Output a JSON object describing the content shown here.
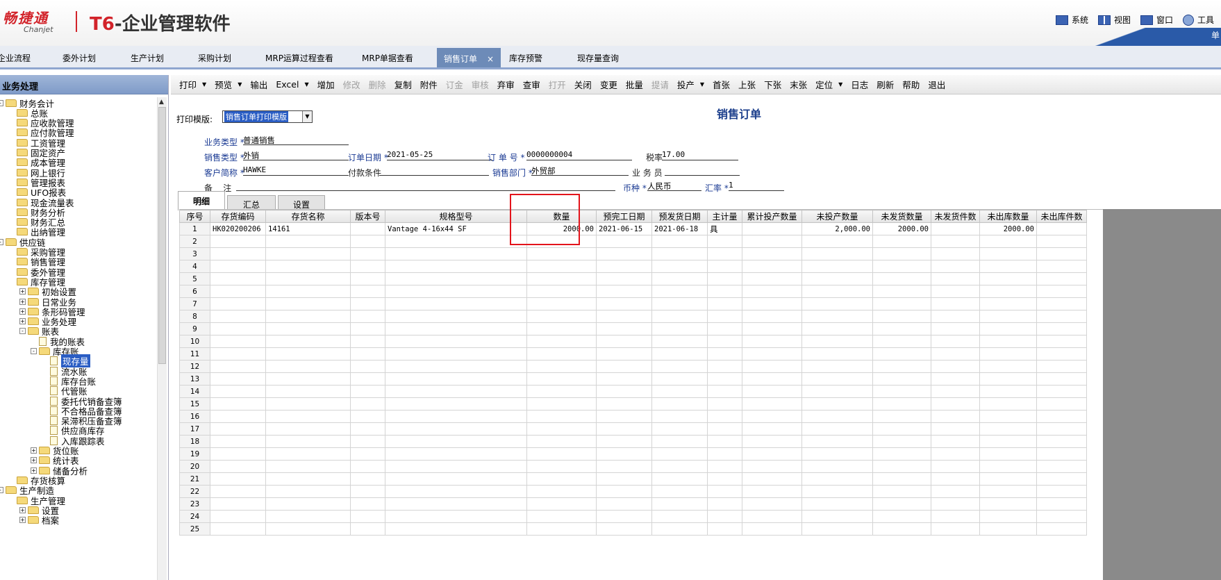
{
  "header": {
    "brand_cn": "畅捷通",
    "brand_en": "Chanjet",
    "product_title_prefix": "T6",
    "product_title": "-企业管理软件",
    "menu": [
      {
        "label": "系统",
        "icon": "monitor-icon"
      },
      {
        "label": "视图",
        "icon": "grid-icon"
      },
      {
        "label": "窗口",
        "icon": "window-icon"
      },
      {
        "label": "工具",
        "icon": "gear-icon"
      }
    ],
    "swoosh_text": "单"
  },
  "tabs": [
    {
      "label": "企业流程"
    },
    {
      "label": "委外计划"
    },
    {
      "label": "生产计划"
    },
    {
      "label": "采购计划"
    },
    {
      "label": "MRP运算过程查看"
    },
    {
      "label": "MRP单据查看"
    },
    {
      "label": "销售订单",
      "active": true,
      "close": "×"
    },
    {
      "label": "库存预警"
    },
    {
      "label": "现存量查询"
    }
  ],
  "left": {
    "title": "业务处理",
    "tree": [
      {
        "label": "财务会计",
        "level": 0,
        "exp": "-",
        "icon": "folder"
      },
      {
        "label": "总账",
        "level": 1,
        "icon": "folder"
      },
      {
        "label": "应收款管理",
        "level": 1,
        "icon": "folder"
      },
      {
        "label": "应付款管理",
        "level": 1,
        "icon": "folder"
      },
      {
        "label": "工资管理",
        "level": 1,
        "icon": "folder"
      },
      {
        "label": "固定资产",
        "level": 1,
        "icon": "folder"
      },
      {
        "label": "成本管理",
        "level": 1,
        "icon": "folder"
      },
      {
        "label": "网上银行",
        "level": 1,
        "icon": "folder"
      },
      {
        "label": "管理报表",
        "level": 1,
        "icon": "folder"
      },
      {
        "label": "UFO报表",
        "level": 1,
        "icon": "folder"
      },
      {
        "label": "现金流量表",
        "level": 1,
        "icon": "folder"
      },
      {
        "label": "财务分析",
        "level": 1,
        "icon": "folder"
      },
      {
        "label": "财务汇总",
        "level": 1,
        "icon": "folder"
      },
      {
        "label": "出纳管理",
        "level": 1,
        "icon": "folder"
      },
      {
        "label": "供应链",
        "level": 0,
        "exp": "-",
        "icon": "folder"
      },
      {
        "label": "采购管理",
        "level": 1,
        "icon": "folder"
      },
      {
        "label": "销售管理",
        "level": 1,
        "icon": "folder"
      },
      {
        "label": "委外管理",
        "level": 1,
        "icon": "folder"
      },
      {
        "label": "库存管理",
        "level": 1,
        "icon": "folder"
      },
      {
        "label": "初始设置",
        "level": 2,
        "exp": "+",
        "icon": "folder"
      },
      {
        "label": "日常业务",
        "level": 2,
        "exp": "+",
        "icon": "folder"
      },
      {
        "label": "条形码管理",
        "level": 2,
        "exp": "+",
        "icon": "folder"
      },
      {
        "label": "业务处理",
        "level": 2,
        "exp": "+",
        "icon": "folder"
      },
      {
        "label": "账表",
        "level": 2,
        "exp": "-",
        "icon": "folder"
      },
      {
        "label": "我的账表",
        "level": 3,
        "icon": "doc"
      },
      {
        "label": "库存账",
        "level": 3,
        "exp": "-",
        "icon": "folder"
      },
      {
        "label": "现存量",
        "level": 4,
        "icon": "doc",
        "selected": true
      },
      {
        "label": "流水账",
        "level": 4,
        "icon": "doc"
      },
      {
        "label": "库存台账",
        "level": 4,
        "icon": "doc"
      },
      {
        "label": "代管账",
        "level": 4,
        "icon": "doc"
      },
      {
        "label": "委托代销备查簿",
        "level": 4,
        "icon": "doc"
      },
      {
        "label": "不合格品备查簿",
        "level": 4,
        "icon": "doc"
      },
      {
        "label": "呆滞积压备查簿",
        "level": 4,
        "icon": "doc"
      },
      {
        "label": "供应商库存",
        "level": 4,
        "icon": "doc"
      },
      {
        "label": "入库跟踪表",
        "level": 4,
        "icon": "doc"
      },
      {
        "label": "货位账",
        "level": 3,
        "exp": "+",
        "icon": "folder"
      },
      {
        "label": "统计表",
        "level": 3,
        "exp": "+",
        "icon": "folder"
      },
      {
        "label": "储备分析",
        "level": 3,
        "exp": "+",
        "icon": "folder"
      },
      {
        "label": "存货核算",
        "level": 1,
        "icon": "folder"
      },
      {
        "label": "生产制造",
        "level": 0,
        "exp": "-",
        "icon": "folder"
      },
      {
        "label": "生产管理",
        "level": 1,
        "icon": "folder"
      },
      {
        "label": "设置",
        "level": 2,
        "exp": "+",
        "icon": "folder"
      },
      {
        "label": "档案",
        "level": 2,
        "exp": "+",
        "icon": "folder"
      }
    ]
  },
  "toolbar": [
    {
      "label": "打印",
      "dd": true
    },
    {
      "label": "预览",
      "dd": true
    },
    {
      "label": "输出"
    },
    {
      "label": "Excel",
      "dd": true
    },
    {
      "label": "增加"
    },
    {
      "label": "修改",
      "disabled": true
    },
    {
      "label": "删除",
      "disabled": true
    },
    {
      "label": "复制"
    },
    {
      "label": "附件"
    },
    {
      "label": "订金",
      "disabled": true
    },
    {
      "label": "审核",
      "disabled": true
    },
    {
      "label": "弃审"
    },
    {
      "label": "查审"
    },
    {
      "label": "打开",
      "disabled": true
    },
    {
      "label": "关闭"
    },
    {
      "label": "变更"
    },
    {
      "label": "批量"
    },
    {
      "label": "提请",
      "disabled": true
    },
    {
      "label": "投产",
      "dd": true
    },
    {
      "label": "首张"
    },
    {
      "label": "上张"
    },
    {
      "label": "下张"
    },
    {
      "label": "末张"
    },
    {
      "label": "定位",
      "dd": true
    },
    {
      "label": "日志"
    },
    {
      "label": "刷新"
    },
    {
      "label": "帮助"
    },
    {
      "label": "退出"
    }
  ],
  "form": {
    "print_template_label": "打印模版:",
    "print_template_value": "销售订单打印模版",
    "doc_title": "销售订单",
    "business_type_label": "业务类型",
    "business_type_value": "普通销售",
    "sales_type_label": "销售类型",
    "sales_type_value": "外销",
    "order_date_label": "订单日期",
    "order_date_value": "2021-05-25",
    "order_no_label": "订 单 号",
    "order_no_value": "0000000004",
    "tax_rate_label": "税率",
    "tax_rate_value": "17.00",
    "customer_label": "客户简称",
    "customer_value": "HAWKE",
    "payment_label": "付款条件",
    "payment_value": "",
    "dept_label": "销售部门",
    "dept_value": "外贸部",
    "salesman_label": "业 务 员",
    "salesman_value": "",
    "remark_label": "备    注",
    "remark_value": "",
    "currency_label": "币种",
    "currency_value": "人民币",
    "exchange_label": "汇率",
    "exchange_value": "1",
    "required_mark": "*"
  },
  "subtabs": [
    {
      "label": "明细",
      "active": true
    },
    {
      "label": "汇总"
    },
    {
      "label": "设置"
    }
  ],
  "grid": {
    "columns": [
      "序号",
      "存货编码",
      "存货名称",
      "版本号",
      "规格型号",
      "数量",
      "预完工日期",
      "预发货日期",
      "主计量",
      "累计投产数量",
      "未投产数量",
      "未发货数量",
      "未发货件数",
      "未出库数量",
      "未出库件数"
    ],
    "row1": [
      "1",
      "HK020200206",
      "14161",
      "",
      "Vantage 4-16x44 SF",
      "2000.00",
      "2021-06-15",
      "2021-06-18",
      "具",
      "",
      "2,000.00",
      "2000.00",
      "",
      "2000.00",
      ""
    ],
    "empty_rows": [
      "2",
      "3",
      "4",
      "5",
      "6",
      "7",
      "8",
      "9",
      "10",
      "11",
      "12",
      "13",
      "14",
      "15",
      "16",
      "17",
      "18",
      "19",
      "20",
      "21",
      "22",
      "23",
      "24",
      "25"
    ]
  },
  "colors": {
    "accent": "#2a5dc4",
    "highlight": "#e3141b",
    "brand": "#d2232a"
  }
}
